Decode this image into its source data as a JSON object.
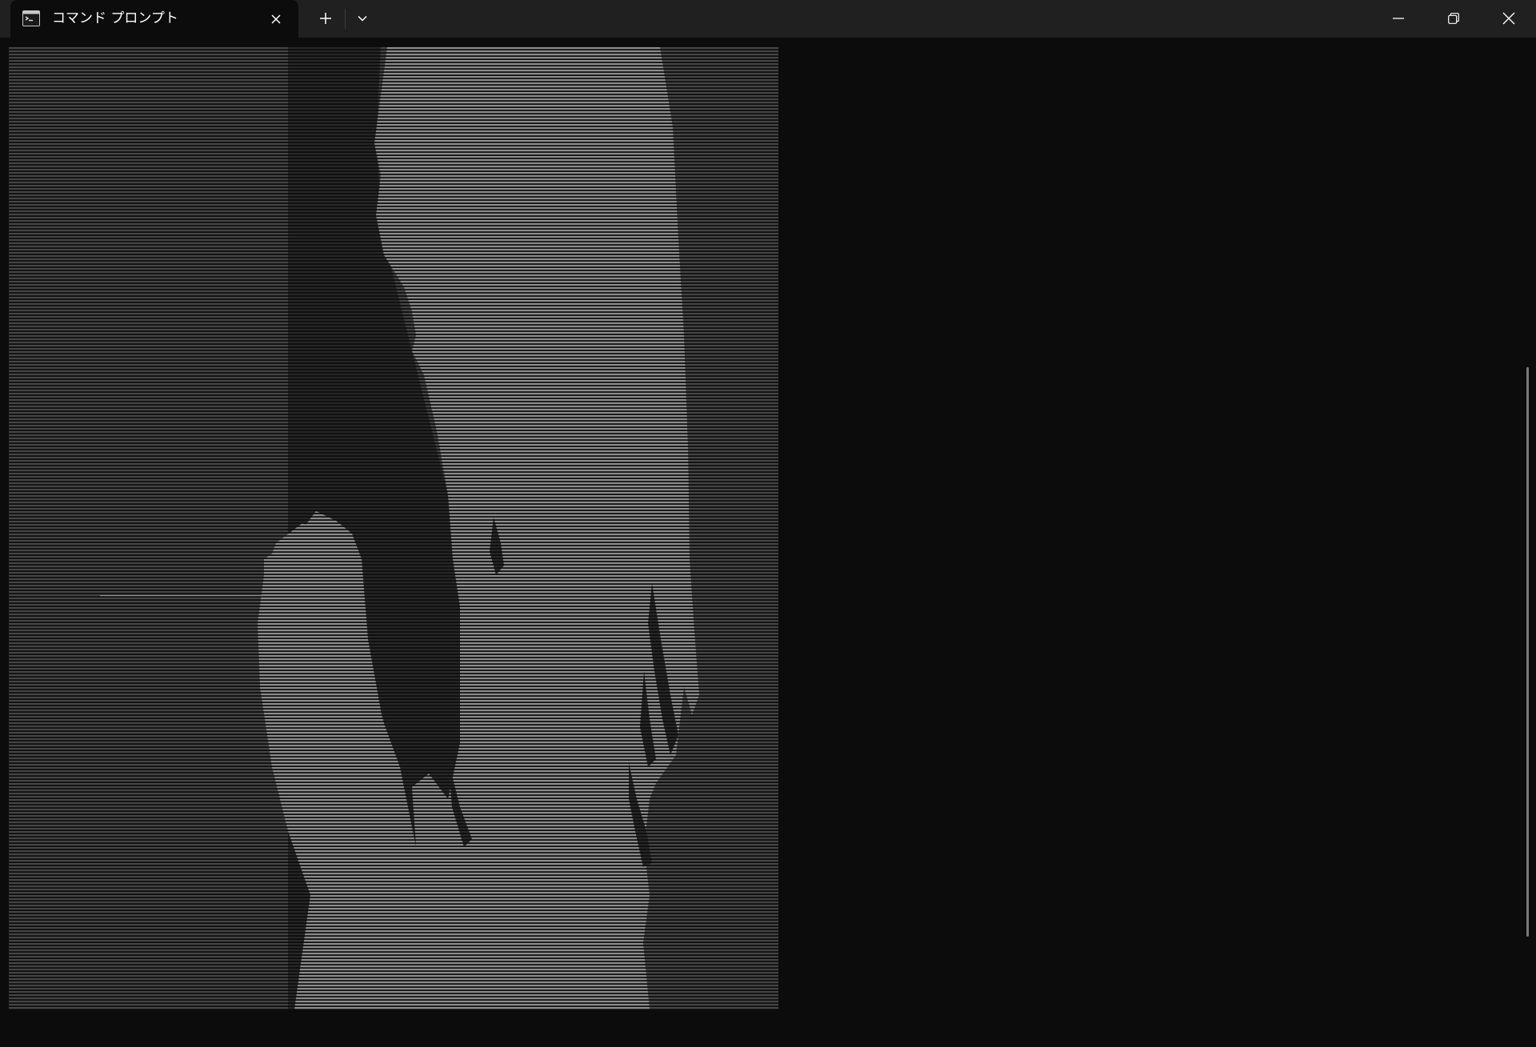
{
  "window": {
    "tab_title": "コマンド プロンプト",
    "icons": {
      "tab": "cmd-terminal-icon",
      "tab_close": "close-icon",
      "new_tab": "plus-icon",
      "dropdown": "chevron-down-icon",
      "minimize": "minimize-icon",
      "restore": "restore-icon",
      "close": "close-icon"
    }
  },
  "terminal": {
    "background": "#0c0c0c",
    "art_light": "#8c8c8c",
    "art_mid": "#454545",
    "art_dark": "#272727",
    "art_content": "ascii-art-silhouette"
  }
}
